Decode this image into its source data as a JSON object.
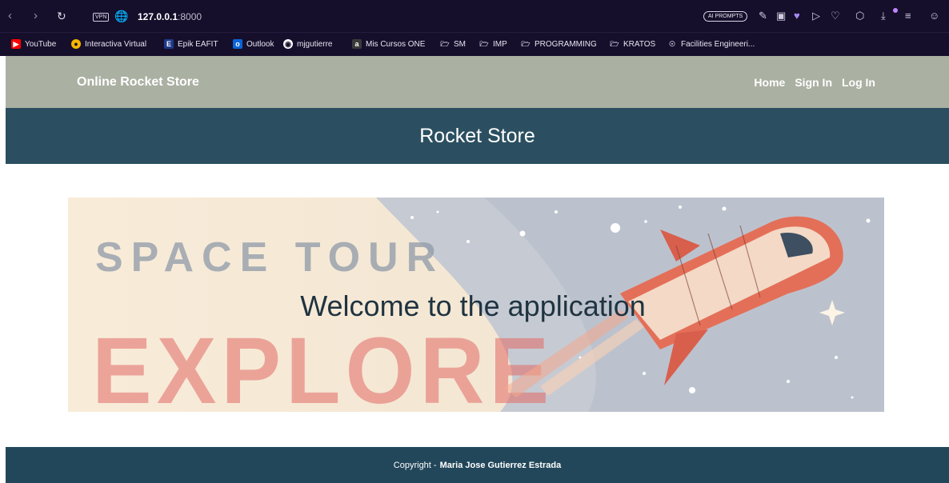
{
  "browser": {
    "vpn_label": "VPN",
    "url_host": "127.0.0.1",
    "url_port": ":8000",
    "ai_prompts_label": "AI PROMPTS",
    "bookmarks": [
      {
        "label": "YouTube",
        "icon": "youtube-icon",
        "color": "#ff0000"
      },
      {
        "label": "Interactiva Virtual",
        "icon": "interactiva-icon",
        "color": "#f4b400"
      },
      {
        "label": "Epik EAFIT",
        "icon": "epik-icon",
        "color": "#1e3a8a"
      },
      {
        "label": "Outlook",
        "icon": "outlook-icon",
        "color": "#0a64d6"
      },
      {
        "label": "mjgutierre",
        "icon": "github-icon",
        "color": "#ffffff"
      },
      {
        "label": "Mis Cursos ONE",
        "icon": "one-icon",
        "color": "#444444"
      },
      {
        "label": "SM",
        "icon": "folder-icon",
        "color": "#cfcde0"
      },
      {
        "label": "IMP",
        "icon": "folder-icon",
        "color": "#cfcde0"
      },
      {
        "label": "PROGRAMMING",
        "icon": "folder-icon",
        "color": "#cfcde0"
      },
      {
        "label": "KRATOS",
        "icon": "folder-icon",
        "color": "#cfcde0"
      },
      {
        "label": "Facilities Engineeri...",
        "icon": "mercedes-icon",
        "color": "#cfcde0"
      }
    ]
  },
  "nav": {
    "brand": "Online Rocket Store",
    "links": [
      "Home",
      "Sign In",
      "Log In"
    ]
  },
  "header": {
    "title": "Rocket Store"
  },
  "banner": {
    "welcome": "Welcome to the application",
    "art_text_top": "SPACE TOUR",
    "art_text_bottom": "EXPLORE"
  },
  "footer": {
    "prefix": "Copyright -",
    "author": "Maria Jose Gutierrez Estrada"
  },
  "colors": {
    "nav_bg": "#aab0a2",
    "header_bg": "#2b4f60",
    "footer_bg": "#22475a",
    "chrome_bg": "#160f2b"
  }
}
